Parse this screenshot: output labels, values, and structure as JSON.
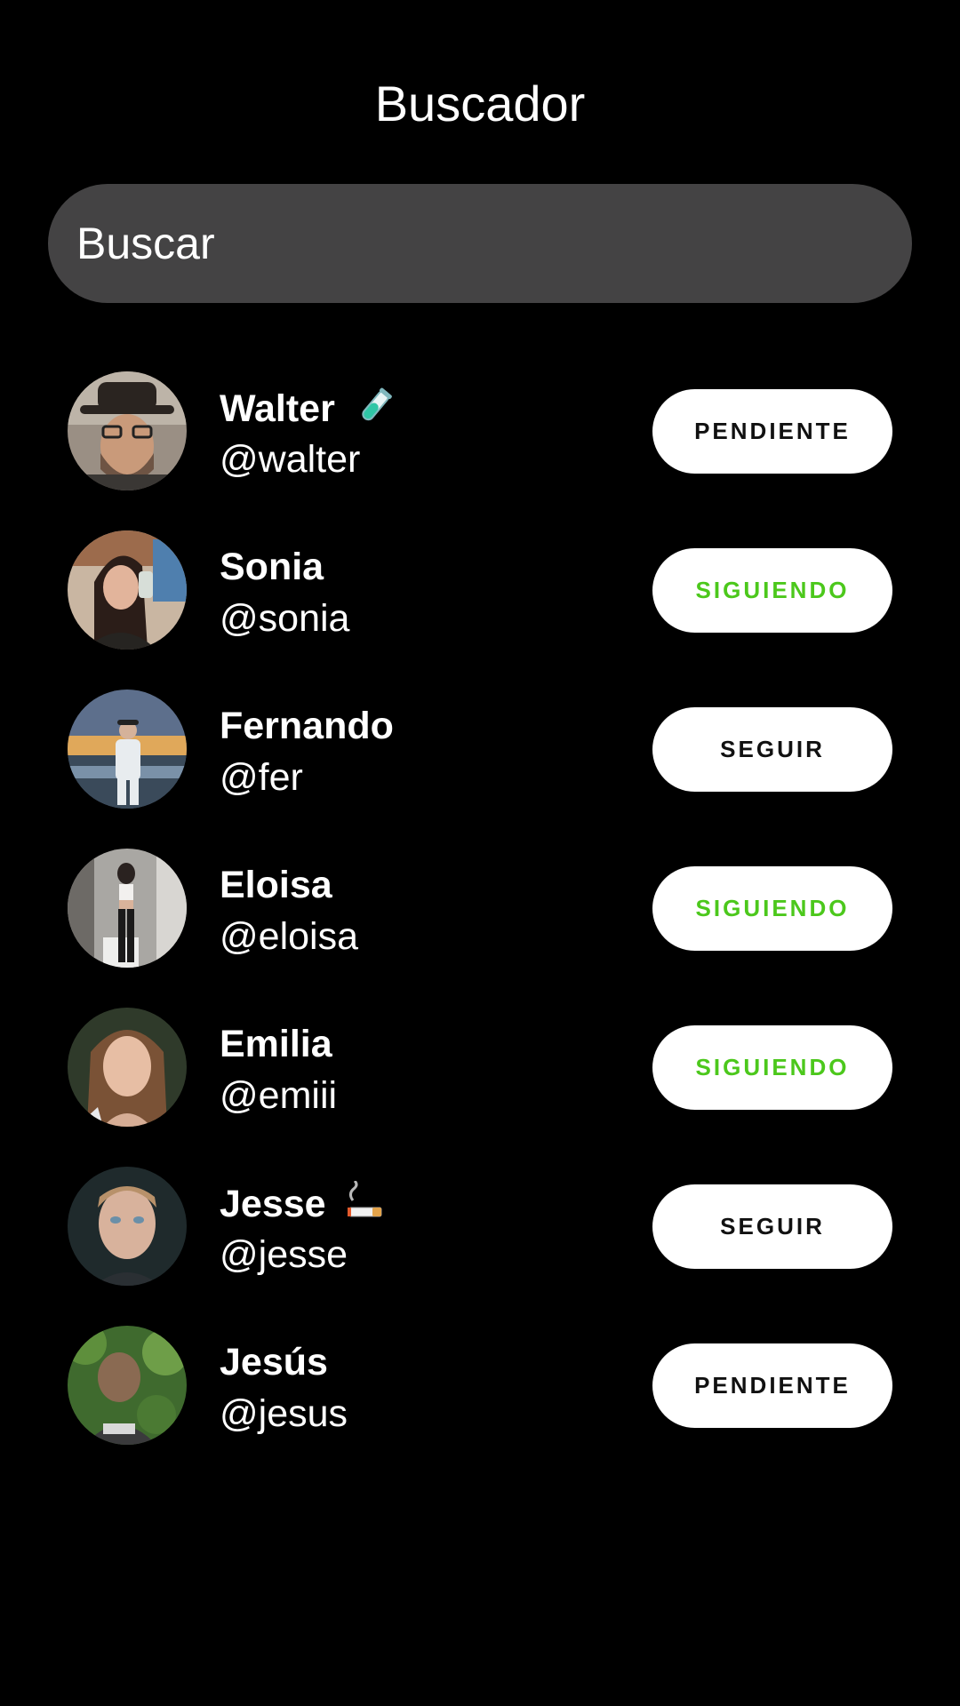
{
  "header": {
    "title": "Buscador"
  },
  "search": {
    "placeholder": "Buscar"
  },
  "colors": {
    "background": "#000000",
    "search_bg": "#444344",
    "button_bg": "#ffffff",
    "button_text": "#111111",
    "following_text": "#4cc81c"
  },
  "users": [
    {
      "name": "Walter",
      "emoji_icon": "test-tube-icon",
      "handle": "@walter",
      "action": "PENDIENTE",
      "status": "pending"
    },
    {
      "name": "Sonia",
      "handle": "@sonia",
      "action": "SIGUIENDO",
      "status": "following"
    },
    {
      "name": "Fernando",
      "handle": "@fer",
      "action": "SEGUIR",
      "status": "follow"
    },
    {
      "name": "Eloisa",
      "handle": "@eloisa",
      "action": "SIGUIENDO",
      "status": "following"
    },
    {
      "name": "Emilia",
      "handle": "@emiii",
      "action": "SIGUIENDO",
      "status": "following"
    },
    {
      "name": "Jesse",
      "emoji_icon": "cigarette-icon",
      "handle": "@jesse",
      "action": "SEGUIR",
      "status": "follow"
    },
    {
      "name": "Jesús",
      "handle": "@jesus",
      "action": "PENDIENTE",
      "status": "pending"
    }
  ]
}
